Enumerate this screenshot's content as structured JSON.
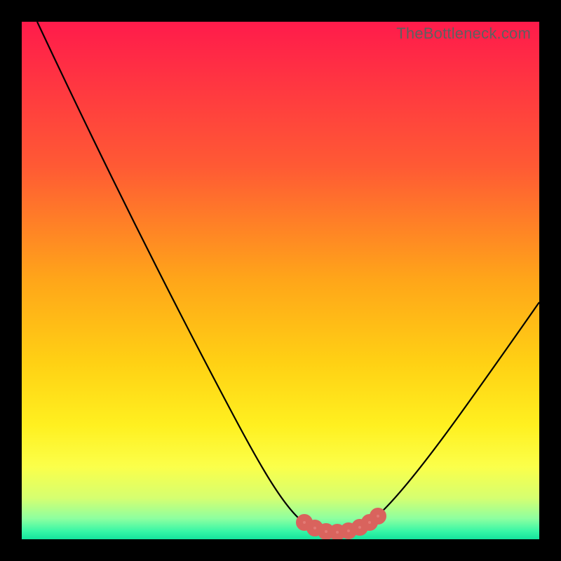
{
  "watermark": "TheBottleneck.com",
  "colors": {
    "frame": "#000000",
    "curve": "#000000",
    "marker_fill": "#e37a75",
    "marker_stroke": "#d9635d"
  },
  "chart_data": {
    "type": "line",
    "title": "",
    "xlabel": "",
    "ylabel": "",
    "xlim": [
      0,
      100
    ],
    "ylim": [
      0,
      100
    ],
    "gradient_stops": [
      {
        "offset": 0.0,
        "color": "#ff1b4b"
      },
      {
        "offset": 0.28,
        "color": "#ff5a34"
      },
      {
        "offset": 0.5,
        "color": "#ffa619"
      },
      {
        "offset": 0.66,
        "color": "#ffd114"
      },
      {
        "offset": 0.78,
        "color": "#fff020"
      },
      {
        "offset": 0.86,
        "color": "#fbff4a"
      },
      {
        "offset": 0.92,
        "color": "#d6ff70"
      },
      {
        "offset": 0.96,
        "color": "#8dffa0"
      },
      {
        "offset": 0.985,
        "color": "#36f6a6"
      },
      {
        "offset": 1.0,
        "color": "#14e39d"
      }
    ],
    "series": [
      {
        "name": "bottleneck-curve",
        "x": [
          3,
          8,
          13,
          18,
          23,
          28,
          33,
          38,
          43,
          48,
          52,
          55,
          58,
          60,
          63,
          66,
          70,
          74,
          78,
          82,
          86,
          90,
          94,
          98,
          100
        ],
        "y": [
          100,
          90,
          80,
          70,
          60,
          50,
          41,
          32,
          23,
          15,
          9,
          5,
          2,
          1,
          1,
          2,
          5,
          10,
          16,
          23,
          30,
          37,
          44,
          51,
          55
        ]
      }
    ],
    "flat_region": {
      "x_start": 55,
      "x_end": 69,
      "y": 1.5,
      "marker_points_x": [
        55,
        57,
        59,
        61,
        63,
        65,
        67,
        69
      ]
    }
  }
}
